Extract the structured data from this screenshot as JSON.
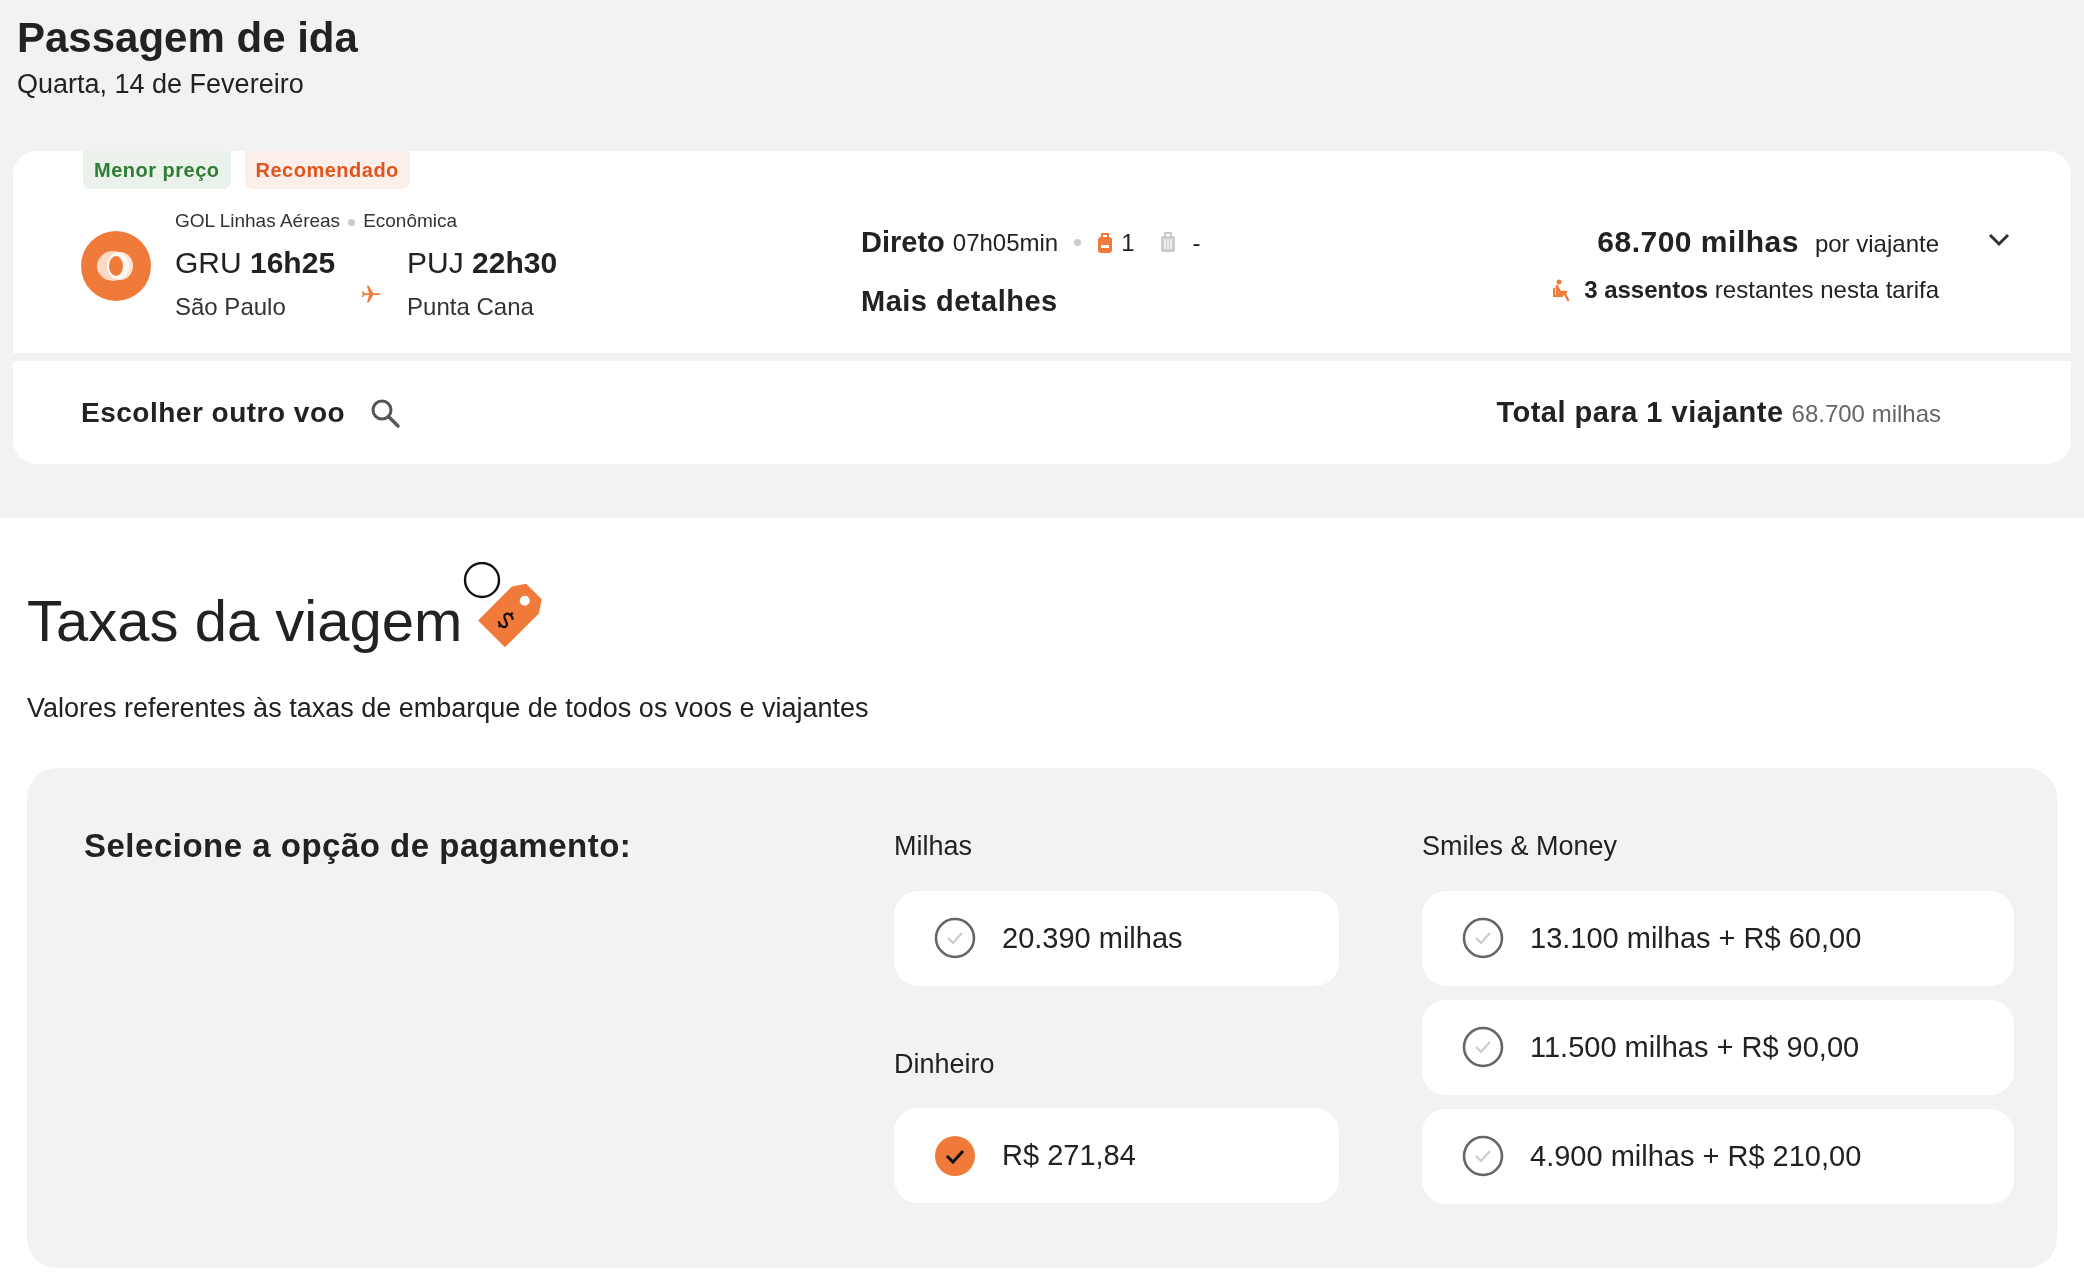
{
  "page_title": "Passagem de ida",
  "date": "Quarta, 14 de Fevereiro",
  "flight": {
    "badges": [
      {
        "label": "Menor preço",
        "color": "#2e7d32"
      },
      {
        "label": "Recomendado",
        "color": "#e0541f"
      }
    ],
    "airline": "GOL Linhas Aéreas",
    "cabin": "Econômica",
    "origin": {
      "code": "GRU",
      "time": "16h25",
      "city": "São Paulo"
    },
    "destination": {
      "code": "PUJ",
      "time": "22h30",
      "city": "Punta Cana"
    },
    "stops": "Direto",
    "duration": "07h05min",
    "carry_on": "1",
    "checked_bag": "-",
    "details_link": "Mais detalhes",
    "price": "68.700 milhas",
    "price_unit": "por viajante",
    "seats": "**3 assentos** restantes nesta tarifa",
    "expanded": false,
    "change_link": "Escolher outro voo",
    "total_label": "Total para 1 viajante",
    "total_value": "68.700 milhas"
  },
  "fees": {
    "title": "Taxas da viagem",
    "subtitle": "Valores referentes às taxas de embarque de todos os voos e viajantes"
  },
  "payment": {
    "title": "Selecione a opção de pagamento:",
    "columns": [
      {
        "groups": [
          {
            "title": "Milhas",
            "options": [
              {
                "label": "20.390 milhas",
                "selected": false
              }
            ]
          },
          {
            "title": "Dinheiro",
            "options": [
              {
                "label": "R$ 271,84",
                "selected": true
              }
            ]
          }
        ]
      },
      {
        "groups": [
          {
            "title": "Smiles & Money",
            "options": [
              {
                "label": "13.100 milhas + R$ 60,00",
                "selected": false
              },
              {
                "label": "11.500 milhas + R$ 90,00",
                "selected": false
              },
              {
                "label": "4.900 milhas + R$ 210,00",
                "selected": false
              }
            ]
          }
        ]
      }
    ]
  }
}
